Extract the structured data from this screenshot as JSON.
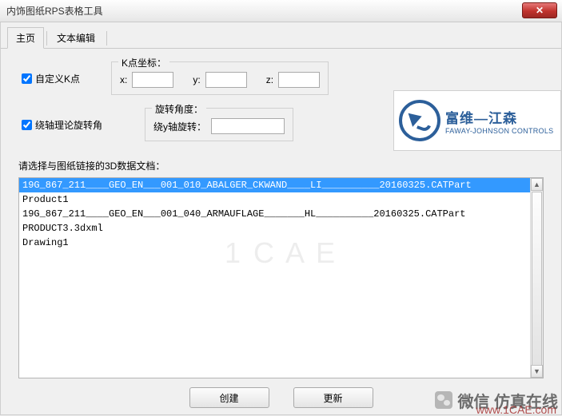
{
  "window": {
    "title": "内饰图纸RPS表格工具",
    "close_glyph": "✕"
  },
  "tabs": {
    "main": "主页",
    "text_edit": "文本编辑"
  },
  "controls": {
    "custom_k": "自定义K点",
    "rotate_axis": "绕轴理论旋转角"
  },
  "k_group": {
    "legend": "K点坐标：",
    "x_label": "x:",
    "y_label": "y:",
    "z_label": "z:",
    "x_value": "",
    "y_value": "",
    "z_value": ""
  },
  "rot_group": {
    "legend": "旋转角度：",
    "label": "绕y轴旋转：",
    "value": ""
  },
  "logo": {
    "cn": "富维—江森",
    "en": "FAWAY-JOHNSON CONTROLS"
  },
  "list_label": "请选择与图纸链接的3D数据文档：",
  "list_items": [
    "19G_867_211____GEO_EN___001_010_ABALGER_CKWAND____LI__________20160325.CATPart",
    "Product1",
    "19G_867_211____GEO_EN___001_040_ARMAUFLAGE_______HL__________20160325.CATPart",
    "PRODUCT3.3dxml",
    "Drawing1"
  ],
  "selected_index": 0,
  "watermark": "1 C A E",
  "buttons": {
    "create": "创建",
    "update": "更新"
  },
  "brand": {
    "text": "微信 仿真在线",
    "url": "www.1CAE.com"
  },
  "scroll": {
    "up": "▲",
    "down": "▼"
  }
}
